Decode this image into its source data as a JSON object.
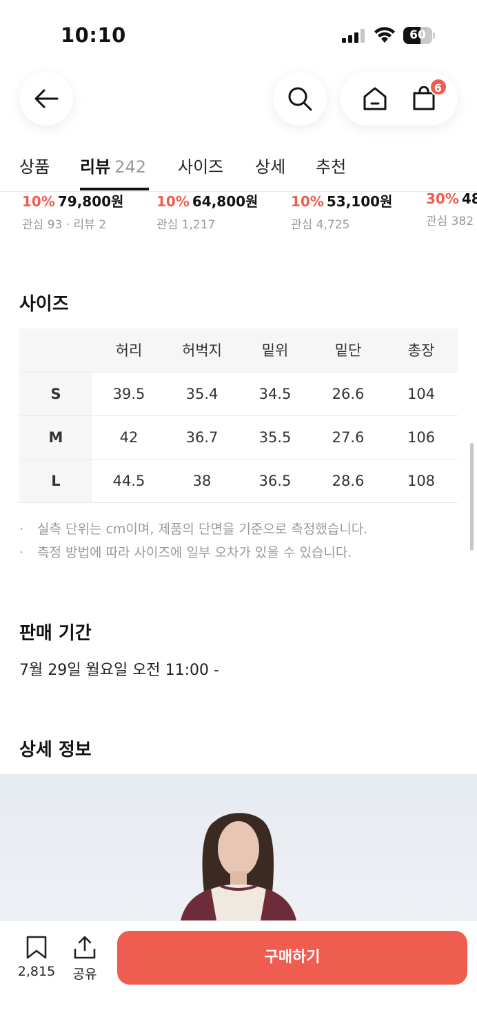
{
  "status_bar": {
    "time": "10:10",
    "battery": "60",
    "battery_level": 0.6
  },
  "cart": {
    "badge": "6"
  },
  "tabs": [
    {
      "label": "상품"
    },
    {
      "label": "리뷰",
      "count": "242"
    },
    {
      "label": "사이즈"
    },
    {
      "label": "상세"
    },
    {
      "label": "추천"
    }
  ],
  "recommendations": [
    {
      "discount": "10%",
      "price": "79,800원",
      "meta": "관심 93 · 리뷰 2"
    },
    {
      "discount": "10%",
      "price": "64,800원",
      "meta": "관심 1,217"
    },
    {
      "discount": "10%",
      "price": "53,100원",
      "meta": "관심 4,725"
    },
    {
      "discount": "30%",
      "price": "48",
      "meta": "관심 382"
    }
  ],
  "size_section": {
    "title": "사이즈",
    "headers": [
      "허리",
      "허벅지",
      "밑위",
      "밑단",
      "총장"
    ],
    "rows": [
      {
        "size": "S",
        "values": [
          "39.5",
          "35.4",
          "34.5",
          "26.6",
          "104"
        ]
      },
      {
        "size": "M",
        "values": [
          "42",
          "36.7",
          "35.5",
          "27.6",
          "106"
        ]
      },
      {
        "size": "L",
        "values": [
          "44.5",
          "38",
          "36.5",
          "28.6",
          "108"
        ]
      }
    ],
    "notes": [
      "실측 단위는 cm이며, 제품의 단면을 기준으로 측정했습니다.",
      "측정 방법에 따라 사이즈에 일부 오차가 있을 수 있습니다."
    ]
  },
  "sale_period": {
    "title": "판매 기간",
    "value": "7월 29일 월요일 오전 11:00 -"
  },
  "detail": {
    "title": "상세 정보"
  },
  "bottom_bar": {
    "bookmark_count": "2,815",
    "share_label": "공유",
    "buy_label": "구매하기"
  },
  "colors": {
    "accent": "#ee5d4f"
  }
}
